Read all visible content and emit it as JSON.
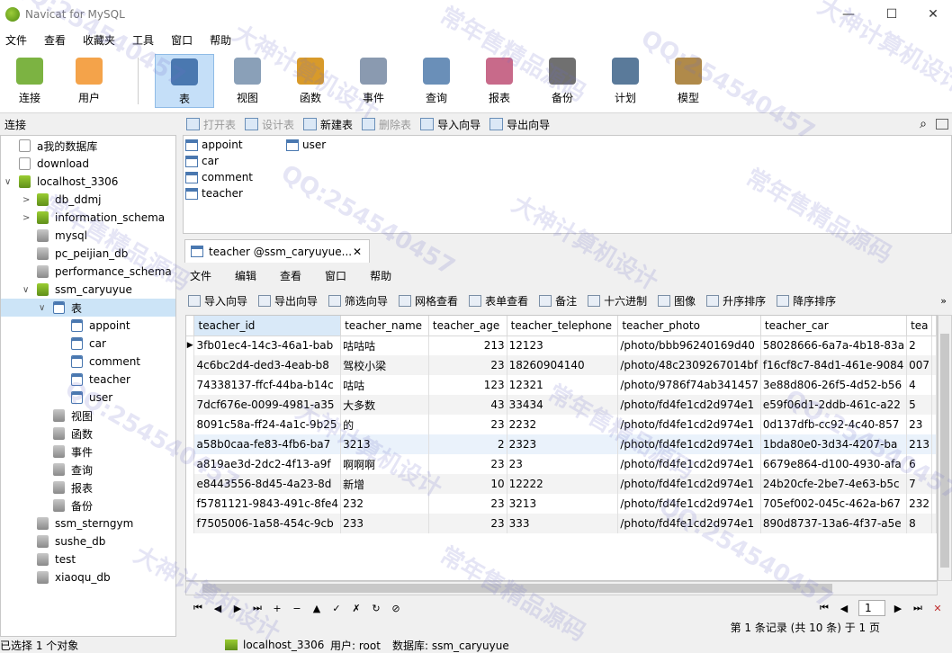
{
  "window": {
    "title": "Navicat for MySQL",
    "minimize": "—",
    "maximize": "☐",
    "close": "✕"
  },
  "menu": [
    "文件",
    "查看",
    "收藏夹",
    "工具",
    "窗口",
    "帮助"
  ],
  "ribbon": [
    {
      "label": "连接",
      "icon": "connection-icon",
      "color": "#7cb342"
    },
    {
      "label": "用户",
      "icon": "user-icon",
      "color": "#f4a34a"
    },
    {
      "label": "表",
      "icon": "table-icon",
      "color": "#4a78b0",
      "active": true
    },
    {
      "label": "视图",
      "icon": "view-icon",
      "color": "#8aa0b8"
    },
    {
      "label": "函数",
      "icon": "function-icon",
      "color": "#d89a2a"
    },
    {
      "label": "事件",
      "icon": "event-icon",
      "color": "#8a9ab0"
    },
    {
      "label": "查询",
      "icon": "query-icon",
      "color": "#6a8fb8"
    },
    {
      "label": "报表",
      "icon": "report-icon",
      "color": "#c86a8a"
    },
    {
      "label": "备份",
      "icon": "backup-icon",
      "color": "#707070"
    },
    {
      "label": "计划",
      "icon": "schedule-icon",
      "color": "#5a7a9a"
    },
    {
      "label": "模型",
      "icon": "model-icon",
      "color": "#b08a4a"
    }
  ],
  "left_header": "连接",
  "object_toolbar": [
    {
      "label": "打开表",
      "disabled": true
    },
    {
      "label": "设计表",
      "disabled": true
    },
    {
      "label": "新建表",
      "disabled": false
    },
    {
      "label": "删除表",
      "disabled": true
    },
    {
      "label": "导入向导",
      "disabled": false
    },
    {
      "label": "导出向导",
      "disabled": false
    }
  ],
  "tree": [
    {
      "label": "a我的数据库",
      "level": 0,
      "icon": "file",
      "arrow": ""
    },
    {
      "label": "download",
      "level": 0,
      "icon": "file",
      "arrow": ""
    },
    {
      "label": "localhost_3306",
      "level": 0,
      "icon": "server",
      "arrow": "∨"
    },
    {
      "label": "db_ddmj",
      "level": 1,
      "icon": "db-open",
      "arrow": ">"
    },
    {
      "label": "information_schema",
      "level": 1,
      "icon": "db-open",
      "arrow": ">"
    },
    {
      "label": "mysql",
      "level": 1,
      "icon": "db",
      "arrow": ""
    },
    {
      "label": "pc_peijian_db",
      "level": 1,
      "icon": "db",
      "arrow": ""
    },
    {
      "label": "performance_schema",
      "level": 1,
      "icon": "db",
      "arrow": ""
    },
    {
      "label": "ssm_caryuyue",
      "level": 1,
      "icon": "db-open",
      "arrow": "∨"
    },
    {
      "label": "表",
      "level": 2,
      "icon": "table",
      "arrow": "∨",
      "selected": true
    },
    {
      "label": "appoint",
      "level": 3,
      "icon": "table",
      "arrow": ""
    },
    {
      "label": "car",
      "level": 3,
      "icon": "table",
      "arrow": ""
    },
    {
      "label": "comment",
      "level": 3,
      "icon": "table",
      "arrow": ""
    },
    {
      "label": "teacher",
      "level": 3,
      "icon": "table",
      "arrow": ""
    },
    {
      "label": "user",
      "level": 3,
      "icon": "table",
      "arrow": ""
    },
    {
      "label": "视图",
      "level": 2,
      "icon": "view",
      "arrow": ""
    },
    {
      "label": "函数",
      "level": 2,
      "icon": "function",
      "arrow": ""
    },
    {
      "label": "事件",
      "level": 2,
      "icon": "event",
      "arrow": ""
    },
    {
      "label": "查询",
      "level": 2,
      "icon": "query",
      "arrow": ""
    },
    {
      "label": "报表",
      "level": 2,
      "icon": "report",
      "arrow": ""
    },
    {
      "label": "备份",
      "level": 2,
      "icon": "backup",
      "arrow": ""
    },
    {
      "label": "ssm_sterngym",
      "level": 1,
      "icon": "db",
      "arrow": ""
    },
    {
      "label": "sushe_db",
      "level": 1,
      "icon": "db",
      "arrow": ""
    },
    {
      "label": "test",
      "level": 1,
      "icon": "db",
      "arrow": ""
    },
    {
      "label": "xiaoqu_db",
      "level": 1,
      "icon": "db",
      "arrow": ""
    }
  ],
  "objects": [
    "appoint",
    "car",
    "comment",
    "teacher",
    "user"
  ],
  "tab": {
    "title": "teacher @ssm_caryuyue...",
    "close": "✕"
  },
  "inner_menu": [
    "文件",
    "编辑",
    "查看",
    "窗口",
    "帮助"
  ],
  "inner_toolbar": [
    "导入向导",
    "导出向导",
    "筛选向导",
    "网格查看",
    "表单查看",
    "备注",
    "十六进制",
    "图像",
    "升序排序",
    "降序排序"
  ],
  "columns": [
    "teacher_id",
    "teacher_name",
    "teacher_age",
    "teacher_telephone",
    "teacher_photo",
    "teacher_car",
    "tea"
  ],
  "rows": [
    [
      "3fb01ec4-14c3-46a1-bab",
      "咕咕咕",
      "213",
      "12123",
      "/photo/bbb96240169d40",
      "58028666-6a7a-4b18-83a",
      "2"
    ],
    [
      "4c6bc2d4-ded3-4eab-b8",
      "驾校小梁",
      "23",
      "18260904140",
      "/photo/48c2309267014bf",
      "f16cf8c7-84d1-461e-9084",
      "007"
    ],
    [
      "74338137-ffcf-44ba-b14c",
      "咕咕",
      "123",
      "12321",
      "/photo/9786f74ab341457",
      "3e88d806-26f5-4d52-b56",
      "4"
    ],
    [
      "7dcf676e-0099-4981-a35",
      "大多数",
      "43",
      "33434",
      "/photo/fd4fe1cd2d974e1",
      "e59f06d1-2ddb-461c-a22",
      "5"
    ],
    [
      "8091c58a-ff24-4a1c-9b25",
      "的",
      "23",
      "2232",
      "/photo/fd4fe1cd2d974e1",
      "0d137dfb-cc92-4c40-857",
      "23"
    ],
    [
      "a58b0caa-fe83-4fb6-ba7",
      "3213",
      "2",
      "2323",
      "/photo/fd4fe1cd2d974e1",
      "1bda80e0-3d34-4207-ba",
      "213"
    ],
    [
      "a819ae3d-2dc2-4f13-a9f",
      "啊啊啊",
      "23",
      "23",
      "/photo/fd4fe1cd2d974e1",
      "6679e864-d100-4930-afa",
      "6"
    ],
    [
      "e8443556-8d45-4a23-8d",
      "新增",
      "10",
      "12222",
      "/photo/fd4fe1cd2d974e1",
      "24b20cfe-2be7-4e63-b5c",
      "7"
    ],
    [
      "f5781121-9843-491c-8fe4",
      "232",
      "23",
      "3213",
      "/photo/fd4fe1cd2d974e1",
      "705ef002-045c-462a-b67",
      "232"
    ],
    [
      "f7505006-1a58-454c-9cb",
      "233",
      "23",
      "333",
      "/photo/fd4fe1cd2d974e1",
      "890d8737-13a6-4f37-a5e",
      "8"
    ]
  ],
  "nav_buttons": [
    "⏮",
    "◀",
    "▶",
    "⏭",
    "+",
    "−",
    "▲",
    "✓",
    "✗",
    "↻",
    "⊘"
  ],
  "pager": {
    "page": "1",
    "first": "⏮",
    "prev": "◀",
    "next": "▶",
    "last": "⏭"
  },
  "record_info": "第 1 条记录 (共 10 条) 于 1 页",
  "status": {
    "selection": "已选择 1 个对象",
    "connection": "localhost_3306",
    "user": "用户: root",
    "database": "数据库: ssm_caryuyue"
  },
  "watermarks": [
    "QQ:254540457",
    "大神计算机设计",
    "常年售精品源码"
  ]
}
